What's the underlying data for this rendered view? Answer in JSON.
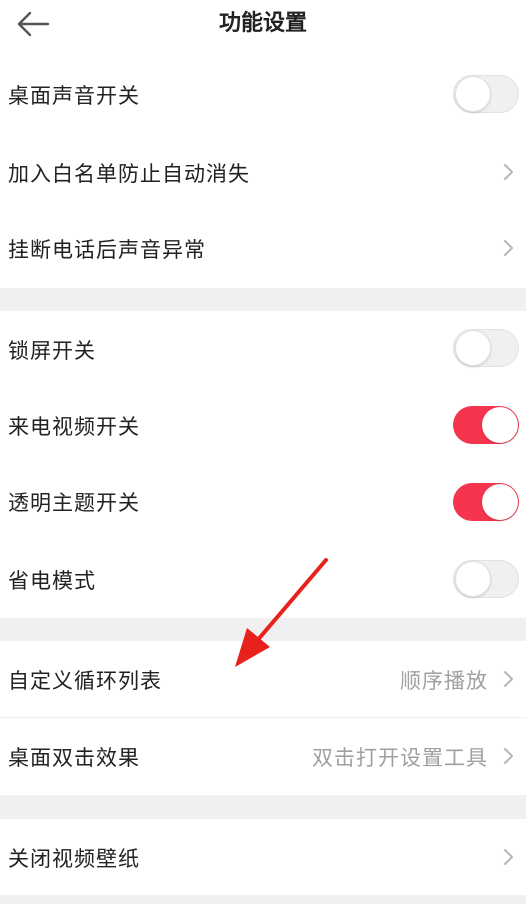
{
  "header": {
    "title": "功能设置",
    "back_icon": "arrow-left-icon"
  },
  "section1": {
    "desktop_sound": {
      "label": "桌面声音开关",
      "enabled": false
    },
    "whitelist": {
      "label": "加入白名单防止自动消失"
    },
    "hangup_sound": {
      "label": "挂断电话后声音异常"
    }
  },
  "section2": {
    "lock_screen": {
      "label": "锁屏开关",
      "enabled": false
    },
    "incoming_video": {
      "label": "来电视频开关",
      "enabled": true
    },
    "transparent_theme": {
      "label": "透明主题开关",
      "enabled": true
    },
    "power_saving": {
      "label": "省电模式",
      "enabled": false
    }
  },
  "section3": {
    "custom_loop": {
      "label": "自定义循环列表",
      "value": "顺序播放"
    },
    "desktop_double_tap": {
      "label": "桌面双击效果",
      "value": "双击打开设置工具"
    }
  },
  "section4": {
    "close_video_wallpaper": {
      "label": "关闭视频壁纸"
    }
  },
  "colors": {
    "accent": "#f5344e",
    "annotation_arrow": "#e8211c",
    "background": "#f0f0f0"
  }
}
